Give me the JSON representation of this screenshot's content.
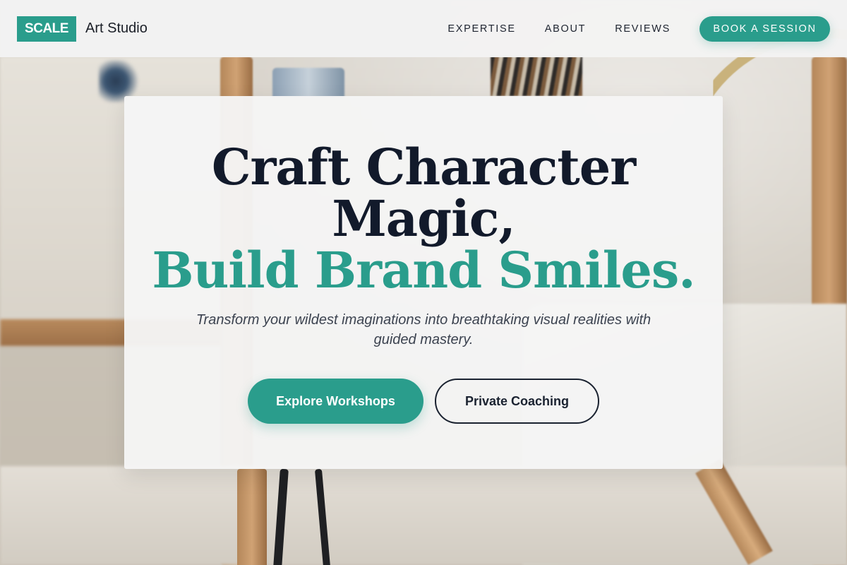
{
  "brand": {
    "badge": "SCALE",
    "name": "Art Studio",
    "accent_color": "#2a9d8c"
  },
  "nav": {
    "links": [
      {
        "label": "EXPERTISE"
      },
      {
        "label": "ABOUT"
      },
      {
        "label": "REVIEWS"
      }
    ],
    "cta_label": "BOOK A SESSION"
  },
  "hero": {
    "headline_line1": "Craft Character",
    "headline_line2": "Magic,",
    "headline_accent": "Build Brand Smiles.",
    "subtitle": "Transform your wildest imaginations into breathtaking visual realities with guided mastery.",
    "primary_cta": "Explore Workshops",
    "secondary_cta": "Private Coaching",
    "headline_color": "#121a2b"
  },
  "background": {
    "image_subject": "art studio with paint brushes, jar, embroidery hoop and cloth"
  }
}
